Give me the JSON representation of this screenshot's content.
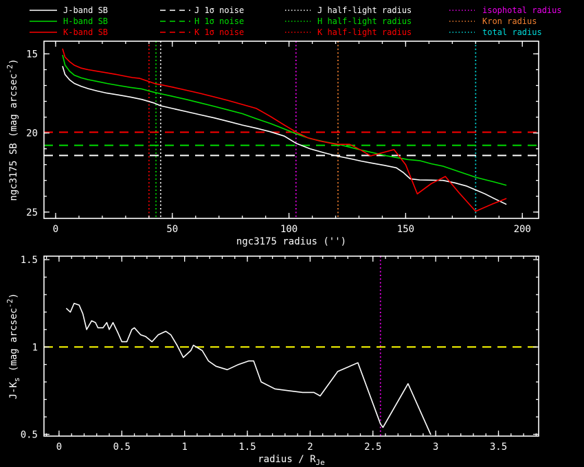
{
  "figure": {
    "background": "#000000",
    "frame_color": "#ffffff",
    "colors": {
      "j_band": "#ffffff",
      "h_band": "#00dd00",
      "k_band": "#ff0000",
      "isophotal": "#ee00ee",
      "kron": "#f28030",
      "total": "#00dddd",
      "unity_line": "#ffff00"
    }
  },
  "legend": {
    "columns": [
      {
        "items": [
          {
            "label": "J-band SB",
            "color": "#ffffff",
            "style": "solid"
          },
          {
            "label": "H-band SB",
            "color": "#00dd00",
            "style": "solid"
          },
          {
            "label": "K-band SB",
            "color": "#ff0000",
            "style": "solid"
          }
        ]
      },
      {
        "items": [
          {
            "label": "J 1σ noise",
            "color": "#ffffff",
            "style": "dashed"
          },
          {
            "label": "H 1σ noise",
            "color": "#00dd00",
            "style": "dashed"
          },
          {
            "label": "K 1σ noise",
            "color": "#ff0000",
            "style": "dashed"
          }
        ]
      },
      {
        "items": [
          {
            "label": "J half-light radius",
            "color": "#ffffff",
            "style": "dotted"
          },
          {
            "label": "H half-light radius",
            "color": "#00dd00",
            "style": "dotted"
          },
          {
            "label": "K half-light radius",
            "color": "#ff0000",
            "style": "dotted"
          }
        ]
      },
      {
        "items": [
          {
            "label": "isophotal radius",
            "color": "#ee00ee",
            "style": "dotted"
          },
          {
            "label": "Kron radius",
            "color": "#f28030",
            "style": "dotted"
          },
          {
            "label": "total radius",
            "color": "#00dddd",
            "style": "dotted"
          }
        ]
      }
    ]
  },
  "chart_data": [
    {
      "id": "top",
      "type": "line",
      "title": "",
      "xlabel": "ngc3175 radius ('')",
      "ylabel": "ngc3175 SB (mag arcsec^{-2})",
      "xlim": [
        -5,
        207
      ],
      "ylim": [
        14.2,
        25.4
      ],
      "y_inverted": true,
      "grid": false,
      "x_minor": 10,
      "y_minor": 1,
      "xticks": [
        {
          "v": 0,
          "label": "0"
        },
        {
          "v": 50,
          "label": "50"
        },
        {
          "v": 100,
          "label": "100"
        },
        {
          "v": 150,
          "label": "150"
        },
        {
          "v": 200,
          "label": "200"
        }
      ],
      "yticks": [
        {
          "v": 15,
          "label": "15"
        },
        {
          "v": 20,
          "label": "20"
        },
        {
          "v": 25,
          "label": "25"
        }
      ],
      "series": [
        {
          "name": "J-band SB",
          "color": "#ffffff",
          "style": "solid",
          "x": [
            3,
            4,
            6,
            8,
            11,
            14,
            18,
            22,
            27,
            32,
            37,
            42,
            45,
            50,
            56,
            62,
            68,
            74,
            80,
            86,
            92,
            98,
            103,
            109,
            115,
            121,
            126,
            131,
            136,
            141,
            146,
            149,
            152,
            156,
            161,
            166,
            171,
            176,
            180,
            184,
            188,
            193
          ],
          "y": [
            15.8,
            16.3,
            16.65,
            16.87,
            17.05,
            17.2,
            17.35,
            17.48,
            17.6,
            17.73,
            17.88,
            18.1,
            18.28,
            18.45,
            18.65,
            18.85,
            19.05,
            19.27,
            19.5,
            19.7,
            19.92,
            20.2,
            20.65,
            21.0,
            21.25,
            21.47,
            21.62,
            21.78,
            21.92,
            22.05,
            22.2,
            22.5,
            22.9,
            22.97,
            22.98,
            23.0,
            23.15,
            23.35,
            23.6,
            23.85,
            24.15,
            24.5
          ]
        },
        {
          "name": "H-band SB",
          "color": "#00dd00",
          "style": "solid",
          "x": [
            3,
            4,
            6,
            8,
            11,
            14,
            18,
            22,
            27,
            32,
            37,
            42,
            45,
            50,
            56,
            62,
            68,
            74,
            80,
            86,
            92,
            98,
            103,
            109,
            115,
            121,
            126,
            131,
            136,
            141,
            146,
            151,
            156,
            161,
            166,
            171,
            176,
            180,
            184,
            188,
            193
          ],
          "y": [
            15.1,
            15.7,
            16.1,
            16.35,
            16.52,
            16.63,
            16.75,
            16.87,
            17.0,
            17.12,
            17.22,
            17.42,
            17.52,
            17.68,
            17.88,
            18.1,
            18.32,
            18.55,
            18.78,
            19.1,
            19.4,
            19.75,
            20.05,
            20.35,
            20.55,
            20.71,
            20.9,
            21.08,
            21.25,
            21.42,
            21.55,
            21.68,
            21.75,
            21.95,
            22.1,
            22.35,
            22.6,
            22.8,
            22.95,
            23.1,
            23.3
          ]
        },
        {
          "name": "K-band SB",
          "color": "#ff0000",
          "style": "solid",
          "x": [
            3,
            4,
            6,
            8,
            11,
            14,
            18,
            22,
            26,
            30,
            33,
            36,
            40,
            43,
            45,
            50,
            56,
            62,
            68,
            74,
            80,
            86,
            92,
            98,
            103,
            108,
            113,
            118,
            121,
            126,
            131,
            135,
            140,
            145,
            150,
            155,
            161,
            167,
            173,
            180,
            187,
            193
          ],
          "y": [
            14.7,
            15.2,
            15.5,
            15.72,
            15.9,
            16.0,
            16.1,
            16.2,
            16.3,
            16.42,
            16.5,
            16.55,
            16.75,
            16.9,
            16.95,
            17.1,
            17.3,
            17.5,
            17.72,
            17.95,
            18.2,
            18.45,
            18.95,
            19.5,
            19.94,
            20.3,
            20.5,
            20.65,
            20.72,
            20.72,
            21.1,
            21.45,
            21.25,
            21.05,
            22.0,
            23.85,
            23.2,
            22.75,
            23.8,
            24.95,
            24.5,
            24.15
          ]
        }
      ],
      "hlines": [
        {
          "name": "J 1σ noise",
          "color": "#ffffff",
          "style": "dashed",
          "y": 21.42
        },
        {
          "name": "H 1σ noise",
          "color": "#00dd00",
          "style": "dashed",
          "y": 20.78
        },
        {
          "name": "K 1σ noise",
          "color": "#ff0000",
          "style": "dashed",
          "y": 19.95
        }
      ],
      "vlines": [
        {
          "name": "K half-light radius",
          "color": "#ff0000",
          "style": "dotted",
          "x": 40
        },
        {
          "name": "H half-light radius",
          "color": "#00dd00",
          "style": "dotted",
          "x": 43
        },
        {
          "name": "J half-light radius",
          "color": "#ffffff",
          "style": "dotted",
          "x": 45
        },
        {
          "name": "isophotal radius",
          "color": "#ee00ee",
          "style": "dotted",
          "x": 103
        },
        {
          "name": "Kron radius",
          "color": "#f28030",
          "style": "dotted",
          "x": 121
        },
        {
          "name": "total radius",
          "color": "#00dddd",
          "style": "dotted",
          "x": 180
        }
      ]
    },
    {
      "id": "bottom",
      "type": "line",
      "title": "",
      "xlabel": "radius / R_{Je}",
      "ylabel": "J-K_{s} (mag arcsec^{-2})",
      "xlim": [
        -0.12,
        3.82
      ],
      "ylim": [
        0.49,
        1.52
      ],
      "y_inverted": false,
      "grid": false,
      "x_minor": 0.1,
      "y_minor": 0.1,
      "xticks": [
        {
          "v": 0,
          "label": "0"
        },
        {
          "v": 0.5,
          "label": "0.5"
        },
        {
          "v": 1,
          "label": "1"
        },
        {
          "v": 1.5,
          "label": "1.5"
        },
        {
          "v": 2,
          "label": "2"
        },
        {
          "v": 2.5,
          "label": "2.5"
        },
        {
          "v": 3,
          "label": "3"
        },
        {
          "v": 3.5,
          "label": "3.5"
        }
      ],
      "yticks": [
        {
          "v": 0.5,
          "label": "0.5"
        },
        {
          "v": 1,
          "label": "1"
        },
        {
          "v": 1.5,
          "label": "1.5"
        }
      ],
      "series": [
        {
          "name": "J-Ks color profile",
          "color": "#ffffff",
          "style": "solid",
          "x": [
            0.06,
            0.09,
            0.12,
            0.16,
            0.19,
            0.22,
            0.26,
            0.29,
            0.31,
            0.35,
            0.38,
            0.4,
            0.43,
            0.47,
            0.5,
            0.54,
            0.58,
            0.6,
            0.65,
            0.69,
            0.74,
            0.79,
            0.85,
            0.89,
            0.94,
            0.99,
            1.05,
            1.07,
            1.14,
            1.19,
            1.25,
            1.34,
            1.43,
            1.51,
            1.55,
            1.61,
            1.72,
            1.83,
            1.94,
            2.03,
            2.08,
            2.22,
            2.38,
            2.56,
            2.58,
            2.78,
            2.96
          ],
          "y": [
            1.22,
            1.2,
            1.25,
            1.24,
            1.19,
            1.1,
            1.15,
            1.14,
            1.11,
            1.11,
            1.14,
            1.1,
            1.14,
            1.08,
            1.03,
            1.03,
            1.1,
            1.11,
            1.07,
            1.06,
            1.03,
            1.07,
            1.09,
            1.07,
            1.01,
            0.94,
            0.98,
            1.01,
            0.98,
            0.92,
            0.89,
            0.87,
            0.9,
            0.92,
            0.92,
            0.8,
            0.76,
            0.75,
            0.74,
            0.74,
            0.72,
            0.86,
            0.91,
            0.56,
            0.54,
            0.79,
            0.5
          ]
        }
      ],
      "hlines": [
        {
          "name": "unity color line",
          "color": "#ffff00",
          "style": "dashed",
          "y": 1.0
        }
      ],
      "vlines": [
        {
          "name": "isophotal radius",
          "color": "#ee00ee",
          "style": "dotted",
          "x": 2.56
        }
      ]
    }
  ]
}
